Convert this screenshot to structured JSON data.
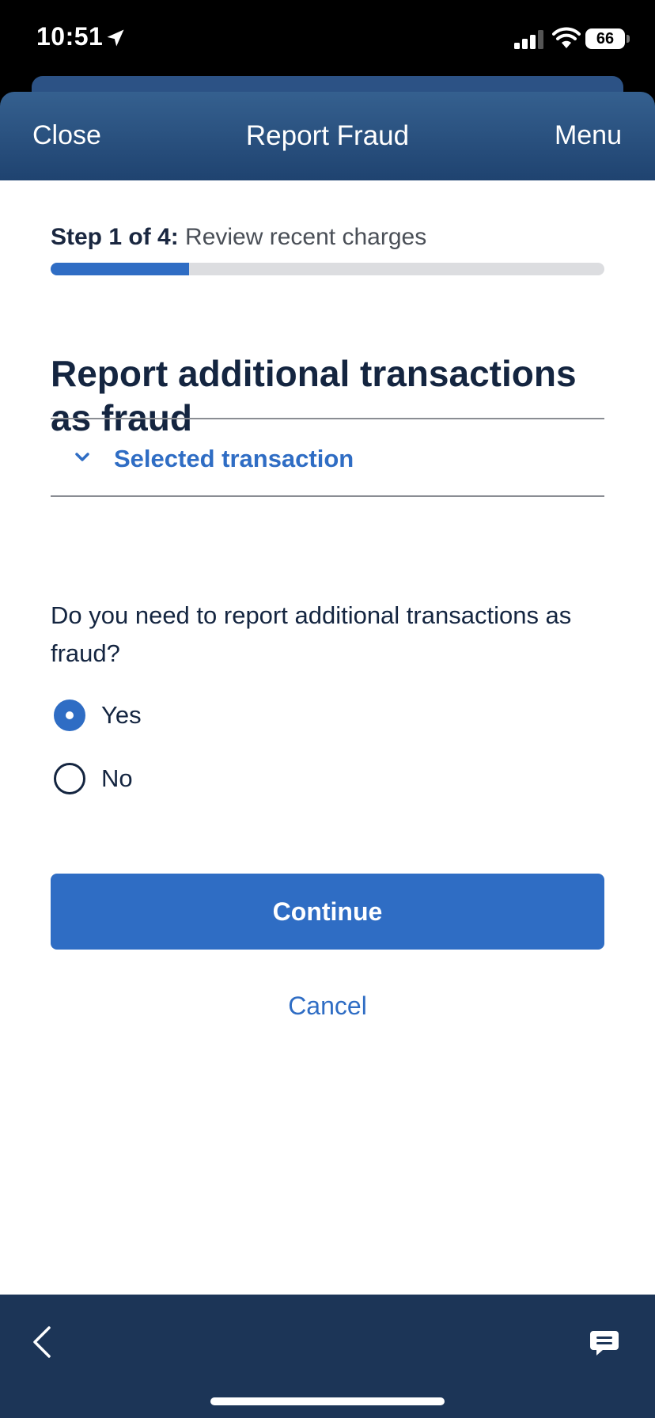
{
  "status_bar": {
    "time": "10:51",
    "battery": "66"
  },
  "header": {
    "close_label": "Close",
    "title": "Report Fraud",
    "menu_label": "Menu"
  },
  "progress": {
    "step_prefix": "Step 1 of 4:",
    "step_text": "Review recent charges",
    "fraction": 0.25,
    "fill_color": "#2f6dc4"
  },
  "page": {
    "title": "Report additional transactions as fraud",
    "accordion_label": "Selected transaction",
    "question": "Do you need to report additional transactions as fraud?"
  },
  "options": [
    {
      "label": "Yes",
      "selected": true
    },
    {
      "label": "No",
      "selected": false
    }
  ],
  "actions": {
    "continue_label": "Continue",
    "cancel_label": "Cancel"
  },
  "colors": {
    "accent": "#2f6dc4",
    "header": "#1f4370",
    "bottom_bar": "#1c3557",
    "text": "#142540"
  },
  "icons": {
    "status": [
      "location-arrow-icon",
      "cellular-signal-icon",
      "wifi-icon",
      "battery-icon"
    ],
    "accordion": "chevron-down-icon",
    "bottom_bar": [
      "back-chevron-icon",
      "chat-icon"
    ]
  }
}
